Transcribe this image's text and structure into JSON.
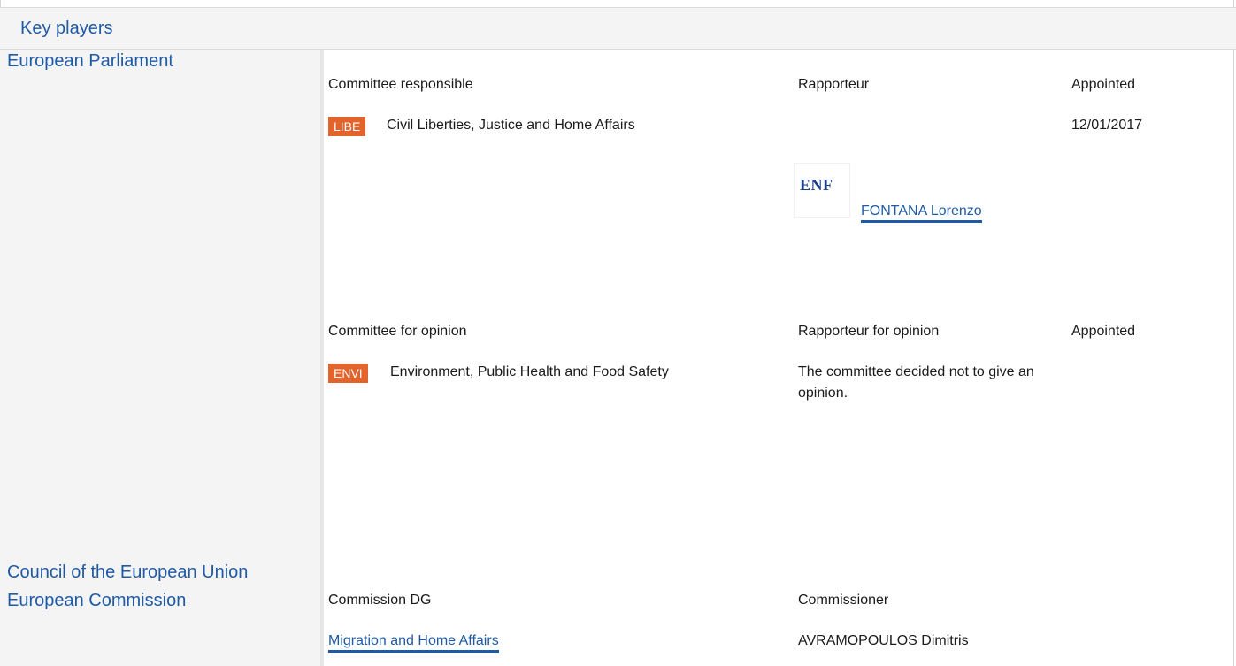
{
  "section_title": "Key players",
  "bodies": {
    "parliament": "European Parliament",
    "council": "Council of the European Union",
    "commission": "European Commission"
  },
  "responsible": {
    "header_committee": "Committee responsible",
    "header_rapporteur": "Rapporteur",
    "header_appointed": "Appointed",
    "committee_code": "LIBE",
    "committee_name": "Civil Liberties, Justice and Home Affairs",
    "appointed_date": "12/01/2017",
    "group_logo": "ENF",
    "rapporteur_name": "FONTANA Lorenzo"
  },
  "opinion": {
    "header_committee": "Committee for opinion",
    "header_rapporteur": "Rapporteur for opinion",
    "header_appointed": "Appointed",
    "committee_code": "ENVI",
    "committee_name": "Environment, Public Health and Food Safety",
    "rapporteur_note": "The committee decided not to give an opinion."
  },
  "commission": {
    "header_dg": "Commission DG",
    "header_commissioner": "Commissioner",
    "dg_name": "Migration and Home Affairs",
    "commissioner_name": "AVRAMOPOULOS Dimitris"
  },
  "colors": {
    "accent_blue": "#1f5aa6",
    "badge_orange": "#e2632b",
    "panel_grey": "#f4f4f4"
  }
}
